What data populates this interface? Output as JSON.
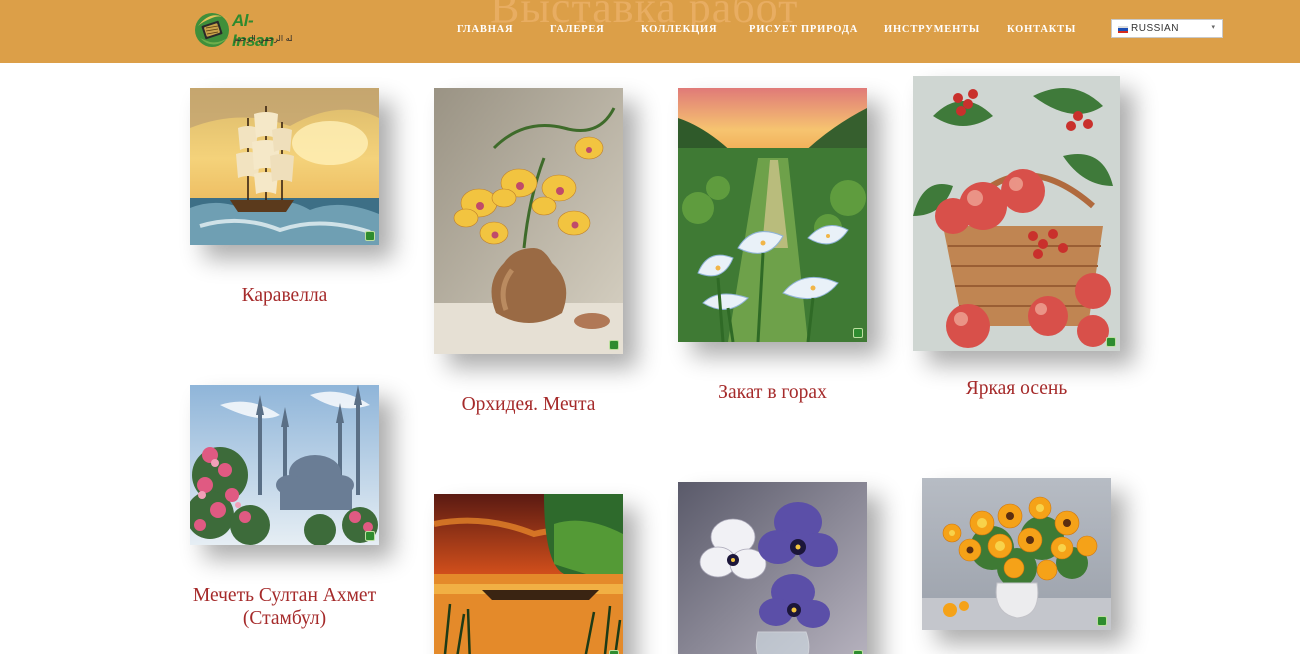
{
  "page": {
    "heading": "Выставка работ"
  },
  "header": {
    "logo_text": "Al-Insan",
    "logo_subtitle": "بسم الله الرحمن الرحيم",
    "nav": [
      {
        "label": "ГЛАВНАЯ"
      },
      {
        "label": "ГАЛЕРЕЯ"
      },
      {
        "label": "КОЛЛЕКЦИЯ"
      },
      {
        "label": "РИСУЕТ ПРИРОДА"
      },
      {
        "label": "ИНСТРУМЕНТЫ"
      },
      {
        "label": "КОНТАКТЫ"
      }
    ],
    "language": "RUSSIAN"
  },
  "gallery": [
    {
      "title": "Каравелла"
    },
    {
      "title": "Орхидея. Мечта"
    },
    {
      "title": "Закат в горах"
    },
    {
      "title": "Яркая осень"
    },
    {
      "title": "Мечеть Султан Ахмет (Стамбул)"
    },
    {
      "title": ""
    },
    {
      "title": ""
    },
    {
      "title": ""
    }
  ],
  "colors": {
    "header_bg": "#dc9f48",
    "caption": "#a52a2a",
    "nav_text": "#ffffff"
  }
}
